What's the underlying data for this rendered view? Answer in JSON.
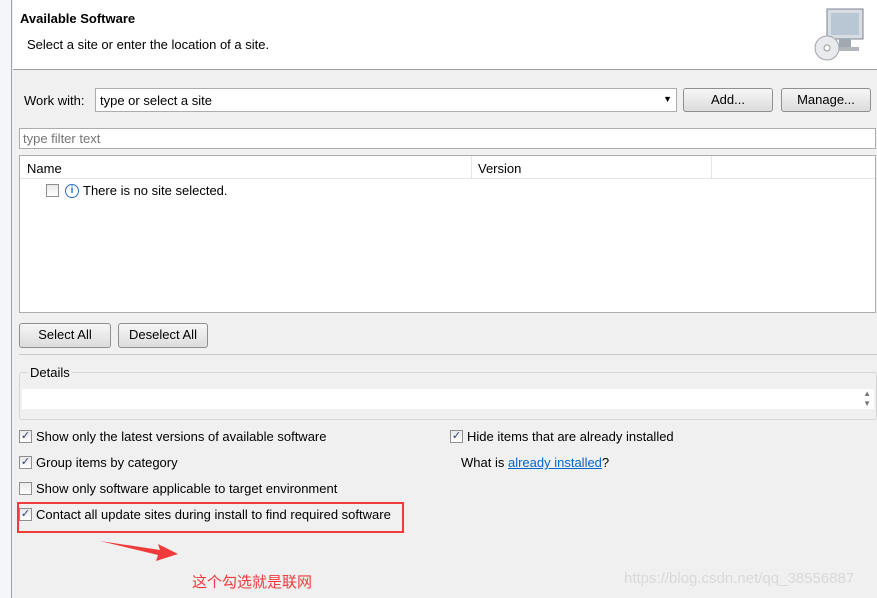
{
  "header": {
    "title": "Available Software",
    "subtitle": "Select a site or enter the location of a site."
  },
  "work_with": {
    "label": "Work with:",
    "value": "type or select a site",
    "add_label": "Add...",
    "manage_label": "Manage..."
  },
  "filter": {
    "placeholder": "type filter text"
  },
  "table": {
    "columns": [
      "Name",
      "Version"
    ],
    "message": "There is no site selected."
  },
  "buttons": {
    "select_all": "Select All",
    "deselect_all": "Deselect All"
  },
  "details": {
    "label": "Details"
  },
  "options": [
    {
      "label": "Show only the latest versions of available software",
      "checked": true
    },
    {
      "label": "Group items by category",
      "checked": true
    },
    {
      "label": "Show only software applicable to target environment",
      "checked": false
    },
    {
      "label": "Contact all update sites during install to find required software",
      "checked": true
    },
    {
      "label": "Hide items that are already installed",
      "checked": true
    }
  ],
  "installed": {
    "prefix": "What is ",
    "link": "already installed",
    "suffix": "?"
  },
  "annotation": {
    "note": "这个勾选就是联网",
    "color": "#f13a3a"
  },
  "watermark": "https://blog.csdn.net/qq_38556887"
}
